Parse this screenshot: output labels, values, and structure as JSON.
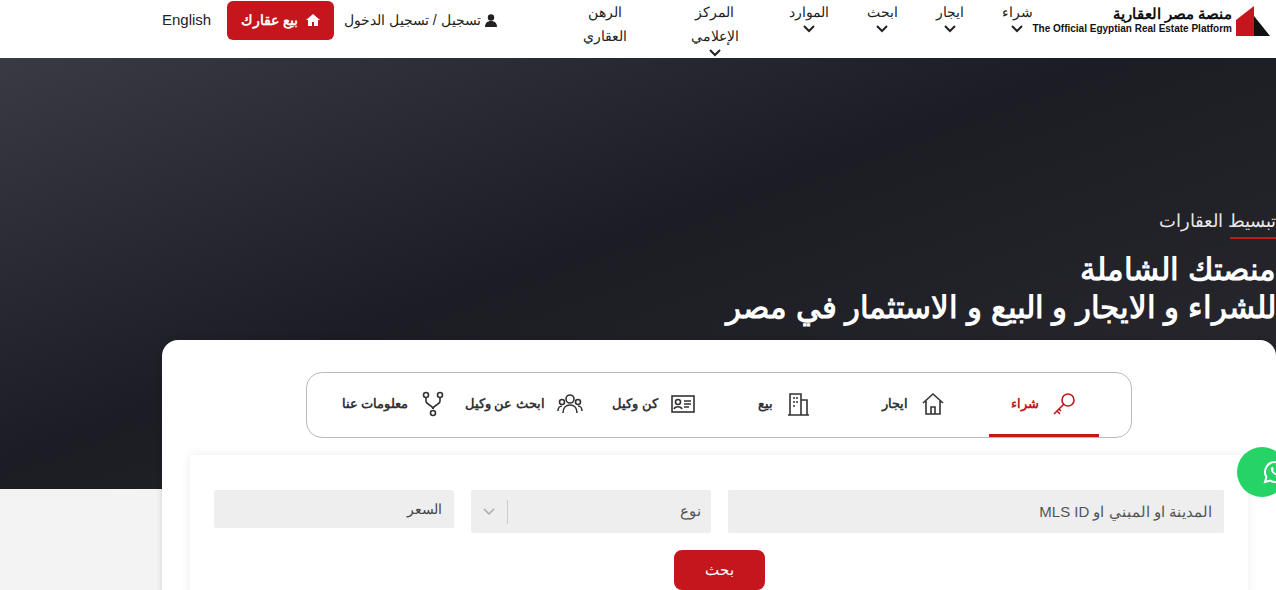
{
  "header": {
    "logo": {
      "arabic": "منصة مصر العقارية",
      "english": "The Official Egyptian Real Estate Platform"
    },
    "nav": [
      {
        "label": "شراء",
        "dropdown": true
      },
      {
        "label": "ايجار",
        "dropdown": true
      },
      {
        "label": "ابحث",
        "dropdown": true
      },
      {
        "label": "الموارد",
        "dropdown": true
      },
      {
        "label": "المركز الإعلامي",
        "dropdown": true
      },
      {
        "label": "الرهن العقاري",
        "dropdown": false
      }
    ],
    "login": "تسجيل / تسجيل الدخول",
    "sell_button": "بيع عقارك",
    "language": "English"
  },
  "hero": {
    "tagline": "تبسيط العقارات",
    "title_lines": [
      "منصتك الشاملة",
      "للشراء و الايجار و البيع و الاستثمار في مصر"
    ]
  },
  "tabs": [
    {
      "label": "شراء",
      "selected": true
    },
    {
      "label": "ايجار",
      "selected": false
    },
    {
      "label": "بيع",
      "selected": false
    },
    {
      "label": "كن وكيل",
      "selected": false
    },
    {
      "label": "ابحث عن وكيل",
      "selected": false
    },
    {
      "label": "معلومات عنا",
      "selected": false
    }
  ],
  "search": {
    "location_placeholder": "المدينة او المبني او MLS ID",
    "type_placeholder": "نوع",
    "price_label": "السعر",
    "button": "بحث"
  }
}
